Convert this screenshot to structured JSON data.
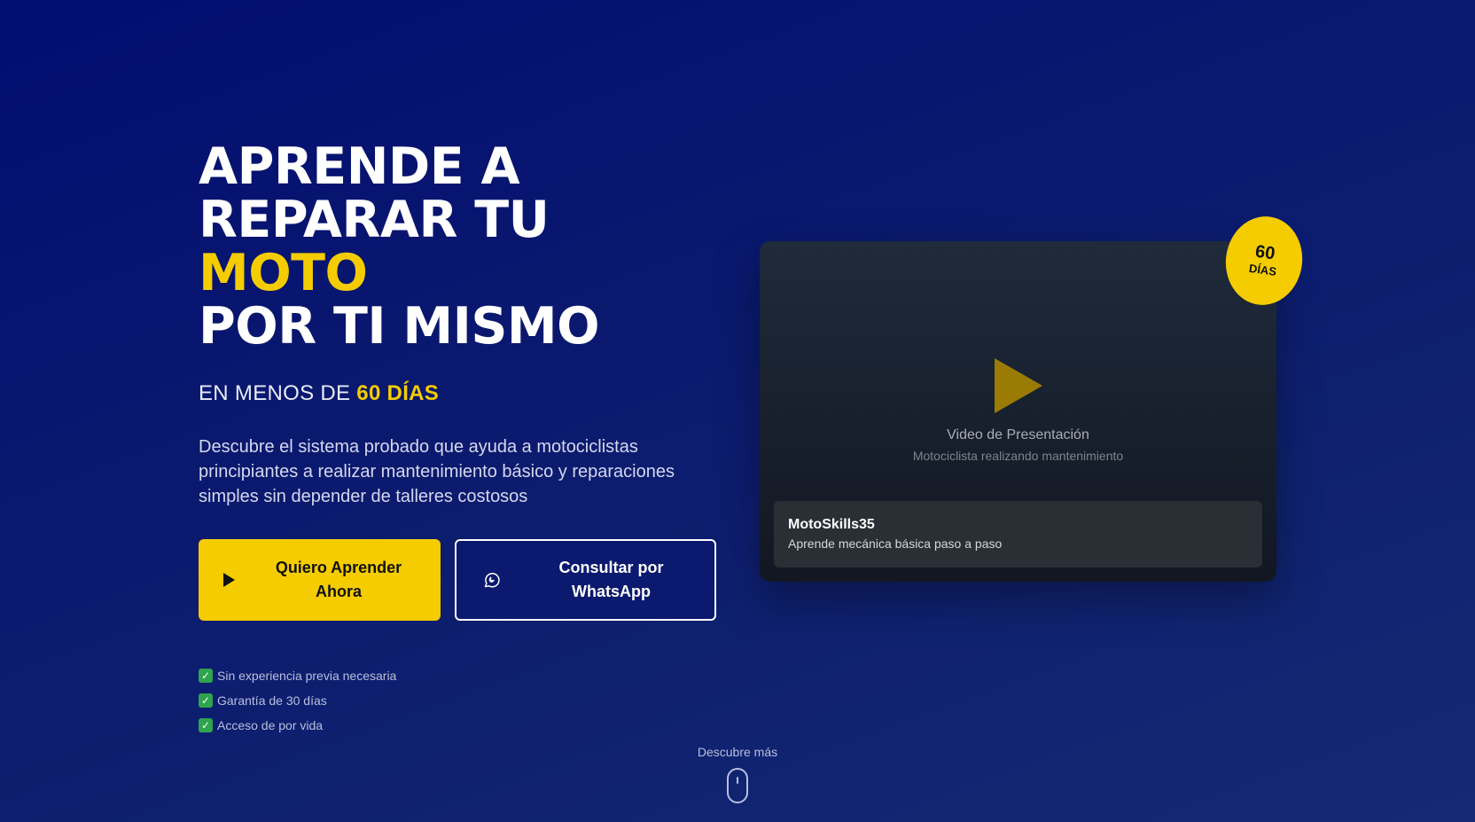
{
  "hero": {
    "headline_line1": "APRENDE A",
    "headline_line2_pre": "REPARAR TU ",
    "headline_line2_accent": "MOTO",
    "headline_line3": "POR TI MISMO",
    "subhead_pre": "EN MENOS DE ",
    "subhead_accent": "60 DÍAS",
    "description": "Descubre el sistema probado que ayuda a motociclistas principiantes a realizar mantenimiento básico y reparaciones simples sin depender de talleres costosos",
    "primary_cta": "Quiero Aprender Ahora",
    "secondary_cta": "Consultar por WhatsApp",
    "features": [
      "Sin experiencia previa necesaria",
      "Garantía de 30 días",
      "Acceso de por vida"
    ]
  },
  "video": {
    "title": "Video de Presentación",
    "subtitle": "Motociclista realizando mantenimiento",
    "brand": "MotoSkills35",
    "tagline": "Aprende mecánica básica paso a paso"
  },
  "badge": {
    "number": "60",
    "unit": "DÍAS"
  },
  "scroll": {
    "label": "Descubre más"
  },
  "colors": {
    "accent": "#f5cc00",
    "background": "#0b1a6e",
    "check": "#2ea44f"
  },
  "icons": [
    "play-icon",
    "whatsapp-icon",
    "check-icon",
    "mouse-icon"
  ]
}
